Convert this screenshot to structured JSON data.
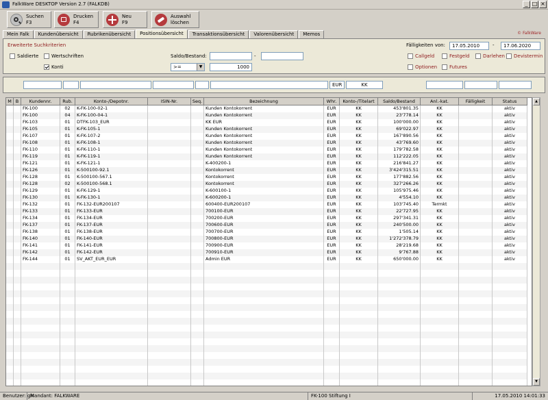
{
  "window": {
    "title": "FalkWare DESKTOP Version 2.7   (FALKDB)"
  },
  "toolbar": {
    "search": {
      "label": "Suchen",
      "key": "F3"
    },
    "print": {
      "label": "Drucken",
      "key": "F4"
    },
    "new": {
      "label": "Neu",
      "key": "F9"
    },
    "clear": {
      "label": "Auswahl",
      "label2": "löschen"
    }
  },
  "tabs": [
    "Mein Falk",
    "Kundenübersicht",
    "Rubrikenübersicht",
    "Positionsübersicht",
    "Transaktionsübersicht",
    "Valorenübersicht",
    "Memos"
  ],
  "brand": "© FalkWare",
  "search": {
    "title": "Erweiterte Suchkriterien",
    "saldierte": "Saldierte",
    "wertschriften": "Wertschriften",
    "konti": "Konti",
    "saldo_label": "Saldo/Bestand:",
    "saldo_from": "",
    "saldo_dash": "-",
    "saldo_to": "",
    "operator": ">=",
    "amount": "1000",
    "faell_label": "Fälligkeiten von:",
    "faell_from": "17.05.2010",
    "faell_dash": "-",
    "faell_to": "17.06.2020",
    "callgeld": "Callgeld",
    "festgeld": "Festgeld",
    "darlehen": "Darlehen",
    "devistermin": "Devistermin",
    "optionen": "Optionen",
    "futures": "Futures"
  },
  "filter": {
    "currency": "EUR",
    "type": "KK"
  },
  "grid": {
    "headers": [
      "M",
      "B",
      "Kundennr.",
      "Rub.",
      "Konto-/Depotnr.",
      "ISIN-Nr.",
      "Seq.",
      "Bezeichnung",
      "Whr.",
      "Konto-/Titelart",
      "Saldo/Bestand",
      "Anl.-kat.",
      "Fälligkeit",
      "Status"
    ],
    "rows": [
      [
        "",
        "",
        "FK-100",
        "02",
        "K-FK-100-02-1",
        "",
        "",
        "Kunden Kontokorrent",
        "EUR",
        "KK",
        "453'801.35",
        "KK",
        "",
        "aktiv"
      ],
      [
        "",
        "",
        "FK-100",
        "04",
        "K-FK-100-04-1",
        "",
        "",
        "Kunden Kontokorrent",
        "EUR",
        "KK",
        "23'778.14",
        "KK",
        "",
        "aktiv"
      ],
      [
        "",
        "",
        "FK-103",
        "01",
        "DTFK-103_EUR",
        "",
        "",
        "KK EUR",
        "EUR",
        "KK",
        "100'000.00",
        "KK",
        "",
        "aktiv"
      ],
      [
        "",
        "",
        "FK-105",
        "01",
        "K-FK-105-1",
        "",
        "",
        "Kunden Kontokorrent",
        "EUR",
        "KK",
        "69'022.97",
        "KK",
        "",
        "aktiv"
      ],
      [
        "",
        "",
        "FK-107",
        "01",
        "K-FK-107-2",
        "",
        "",
        "Kunden Kontokorrent",
        "EUR",
        "KK",
        "167'890.56",
        "KK",
        "",
        "aktiv"
      ],
      [
        "",
        "",
        "FK-108",
        "01",
        "K-FK-108-1",
        "",
        "",
        "Kunden Kontokorrent",
        "EUR",
        "KK",
        "43'769.60",
        "KK",
        "",
        "aktiv"
      ],
      [
        "",
        "",
        "FK-110",
        "01",
        "K-FK-110-1",
        "",
        "",
        "Kunden Kontokorrent",
        "EUR",
        "KK",
        "179'782.58",
        "KK",
        "",
        "aktiv"
      ],
      [
        "",
        "",
        "FK-119",
        "01",
        "K-FK-119-1",
        "",
        "",
        "Kunden Kontokorrent",
        "EUR",
        "KK",
        "112'222.05",
        "KK",
        "",
        "aktiv"
      ],
      [
        "",
        "",
        "FK-121",
        "01",
        "K-FK-121-1",
        "",
        "",
        "K-400200-1",
        "EUR",
        "KK",
        "216'841.27",
        "KK",
        "",
        "aktiv"
      ],
      [
        "",
        "",
        "FK-126",
        "01",
        "K-500100-92.1",
        "",
        "",
        "Kontokorrent",
        "EUR",
        "KK",
        "3'424'315.51",
        "KK",
        "",
        "aktiv"
      ],
      [
        "",
        "",
        "FK-128",
        "01",
        "K-500100-567.1",
        "",
        "",
        "Kontokorrent",
        "EUR",
        "KK",
        "177'882.56",
        "KK",
        "",
        "aktiv"
      ],
      [
        "",
        "",
        "FK-128",
        "02",
        "K-500100-568.1",
        "",
        "",
        "Kontokorrent",
        "EUR",
        "KK",
        "327'266.26",
        "KK",
        "",
        "aktiv"
      ],
      [
        "",
        "",
        "FK-129",
        "01",
        "K-FK-129-1",
        "",
        "",
        "K-600100-1",
        "EUR",
        "KK",
        "105'975.46",
        "KK",
        "",
        "aktiv"
      ],
      [
        "",
        "",
        "FK-130",
        "01",
        "K-FK-130-1",
        "",
        "",
        "K-600200-1",
        "EUR",
        "KK",
        "4'554.10",
        "KK",
        "",
        "aktiv"
      ],
      [
        "",
        "",
        "FK-132",
        "01",
        "FK-132-EUR200107",
        "",
        "",
        "600400-EUR200107",
        "EUR",
        "KK",
        "103'745.40",
        "Termkt",
        "",
        "aktiv"
      ],
      [
        "",
        "",
        "FK-133",
        "01",
        "FK-133-EUR",
        "",
        "",
        "700100-EUR",
        "EUR",
        "KK",
        "22'727.95",
        "KK",
        "",
        "aktiv"
      ],
      [
        "",
        "",
        "FK-134",
        "01",
        "FK-134-EUR",
        "",
        "",
        "700200-EUR",
        "EUR",
        "KK",
        "297'341.31",
        "KK",
        "",
        "aktiv"
      ],
      [
        "",
        "",
        "FK-137",
        "01",
        "FK-137-EUR",
        "",
        "",
        "700600-EUR",
        "EUR",
        "KK",
        "240'500.00",
        "KK",
        "",
        "aktiv"
      ],
      [
        "",
        "",
        "FK-138",
        "01",
        "FK-138-EUR",
        "",
        "",
        "700700-EUR",
        "EUR",
        "KK",
        "1'505.14",
        "KK",
        "",
        "aktiv"
      ],
      [
        "",
        "",
        "FK-140",
        "01",
        "FK-140-EUR",
        "",
        "",
        "700800-EUR",
        "EUR",
        "KK",
        "1'272'378.79",
        "KK",
        "",
        "aktiv"
      ],
      [
        "",
        "",
        "FK-141",
        "01",
        "FK-141-EUR",
        "",
        "",
        "700900-EUR",
        "EUR",
        "KK",
        "28'219.68",
        "KK",
        "",
        "aktiv"
      ],
      [
        "",
        "",
        "FK-142",
        "01",
        "FK-142-EUR",
        "",
        "",
        "700910-EUR",
        "EUR",
        "KK",
        "9'767.88",
        "KK",
        "",
        "aktiv"
      ],
      [
        "",
        "",
        "FK-144",
        "01",
        "SV_AKT_EUR_EUR",
        "",
        "",
        "Admin EUR",
        "EUR",
        "KK",
        "650'000.00",
        "KK",
        "",
        "aktiv"
      ]
    ]
  },
  "status": {
    "user": "Benutzer: gh",
    "mandant": "Mandant: FALKWARE",
    "client": "FK-100  Stiftung I",
    "datetime": "17.05.2010 14:01:33"
  }
}
